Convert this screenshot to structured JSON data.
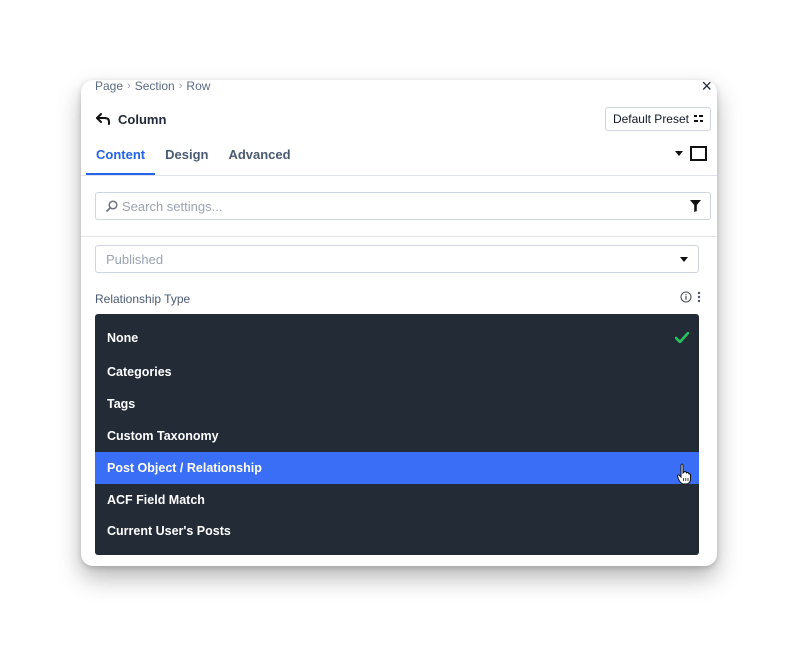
{
  "breadcrumb": [
    "Page",
    "Section",
    "Row"
  ],
  "close_label": "×",
  "header": {
    "title": "Column",
    "preset": "Default Preset"
  },
  "tabs": [
    "Content",
    "Design",
    "Advanced"
  ],
  "search": {
    "placeholder": "Search settings..."
  },
  "status_select": {
    "value": "Published"
  },
  "relationship": {
    "label": "Relationship Type",
    "options": [
      "None",
      "Categories",
      "Tags",
      "Custom Taxonomy",
      "Post Object / Relationship",
      "ACF Field Match",
      "Current User's Posts"
    ],
    "selected": "None",
    "hovered": "Post Object / Relationship"
  },
  "colors": {
    "accent": "#2563eb",
    "dropdown_bg": "#232b37",
    "highlight": "#3b6ef6",
    "check": "#22c55e"
  }
}
